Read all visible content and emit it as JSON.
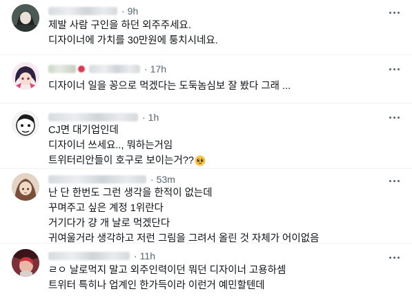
{
  "replies": [
    {
      "time": "9h",
      "lines": [
        "제발 사람 구인을 하던 외주주세요.",
        "디자이너에 가치를 30만원에 퉁치시네요."
      ]
    },
    {
      "time": "17h",
      "lines": [
        "디자이너 일을 꽁으로 먹겠다는 도둑놈심보 잘 봤다 그래 ..."
      ]
    },
    {
      "time": "1h",
      "lines": [
        "CJ면 대기업인데",
        "디자이너 쓰세요.., 뭐하는거임",
        "트위터리안들이 호구로 보이는거??"
      ],
      "emoji": "pleading-face-emoji"
    },
    {
      "time": "53m",
      "lines": [
        "난 단 한번도 그런 생각을 한적이 없는데",
        "꾸며주고 싶은 계정 1위란다",
        "거기다가 걍 개 날로 먹겠단다",
        "귀여울거라 생각하고 저런 그림을 그려서 올린 것 자체가 어이없음"
      ]
    },
    {
      "time": "11h",
      "lines": [
        "ㄹㅇ 날로먹지 말고 외주인력이던 뭐던 디자이너 고용하셈",
        "트위터 특히나 업계인 한가득이라 이런거 예민할텐데"
      ]
    }
  ],
  "colors": {
    "text": "#0f1419",
    "muted": "#536471",
    "divider": "#eff3f4"
  }
}
